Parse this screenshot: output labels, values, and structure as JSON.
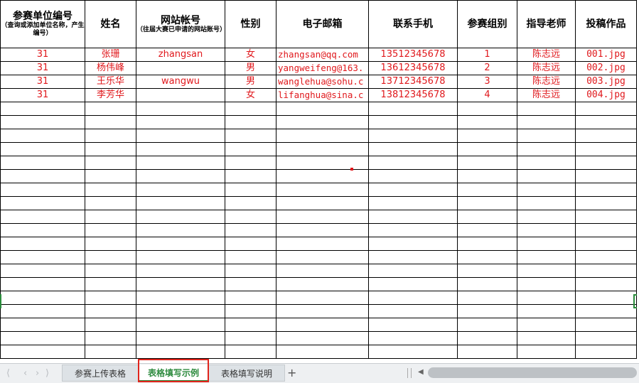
{
  "headers": {
    "c1_main": "参赛单位编号",
    "c1_sub": "（查询或添加单位名称，产生编号）",
    "c2": "姓名",
    "c3_main": "网站帐号",
    "c3_sub": "（往届大赛已申请的网站账号）",
    "c4": "性别",
    "c5": "电子邮箱",
    "c6": "联系手机",
    "c7": "参赛组别",
    "c8": "指导老师",
    "c9": "投稿作品"
  },
  "rows": [
    {
      "unit": "31",
      "name": "张珊",
      "account": "zhangsan",
      "gender": "女",
      "email": "zhangsan@qq.com",
      "phone": "13512345678",
      "group": "1",
      "teacher": "陈志远",
      "work": "001.jpg"
    },
    {
      "unit": "31",
      "name": "杨伟峰",
      "account": "",
      "gender": "男",
      "email": "yangweifeng@163.",
      "phone": "13612345678",
      "group": "2",
      "teacher": "陈志远",
      "work": "002.jpg"
    },
    {
      "unit": "31",
      "name": "王乐华",
      "account": "wangwu",
      "gender": "男",
      "email": "wanglehua@sohu.c",
      "phone": "13712345678",
      "group": "3",
      "teacher": "陈志远",
      "work": "003.jpg"
    },
    {
      "unit": "31",
      "name": "李芳华",
      "account": "",
      "gender": "女",
      "email": "lifanghua@sina.c",
      "phone": "13812345678",
      "group": "4",
      "teacher": "陈志远",
      "work": "004.jpg"
    }
  ],
  "tabs": {
    "tab1": "参赛上传表格",
    "tab2": "表格填写示例",
    "tab3": "表格填写说明",
    "add": "+"
  },
  "colors": {
    "data_text": "#e0181c",
    "active_tab": "#2e8b3f",
    "highlight": "#e0241c"
  }
}
